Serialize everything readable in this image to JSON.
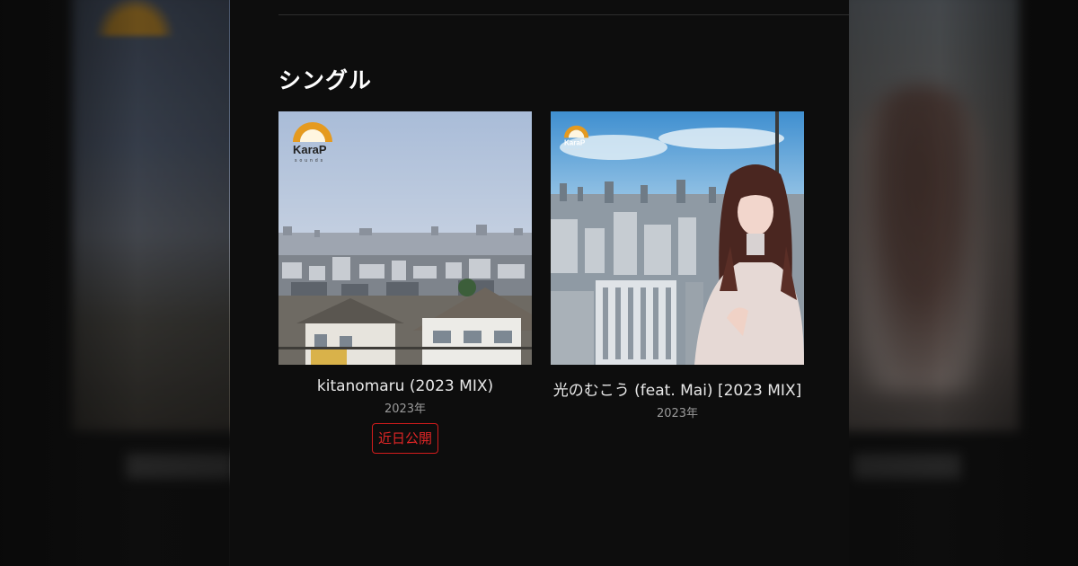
{
  "section": {
    "title": "シングル"
  },
  "cards": [
    {
      "title": "kitanomaru (2023 MIX)",
      "year": "2023年",
      "badge": "近日公開",
      "logo": {
        "name": "KaraP",
        "sub": "sounds"
      }
    },
    {
      "title": "光のむこう (feat. Mai) [2023 MIX]",
      "year": "2023年",
      "logo": {
        "name": "KaraP",
        "sub": "sounds"
      }
    }
  ],
  "colors": {
    "accent_red": "#d31c1c",
    "logo_orange": "#e59a1f",
    "panel": "#0d0d0d"
  }
}
